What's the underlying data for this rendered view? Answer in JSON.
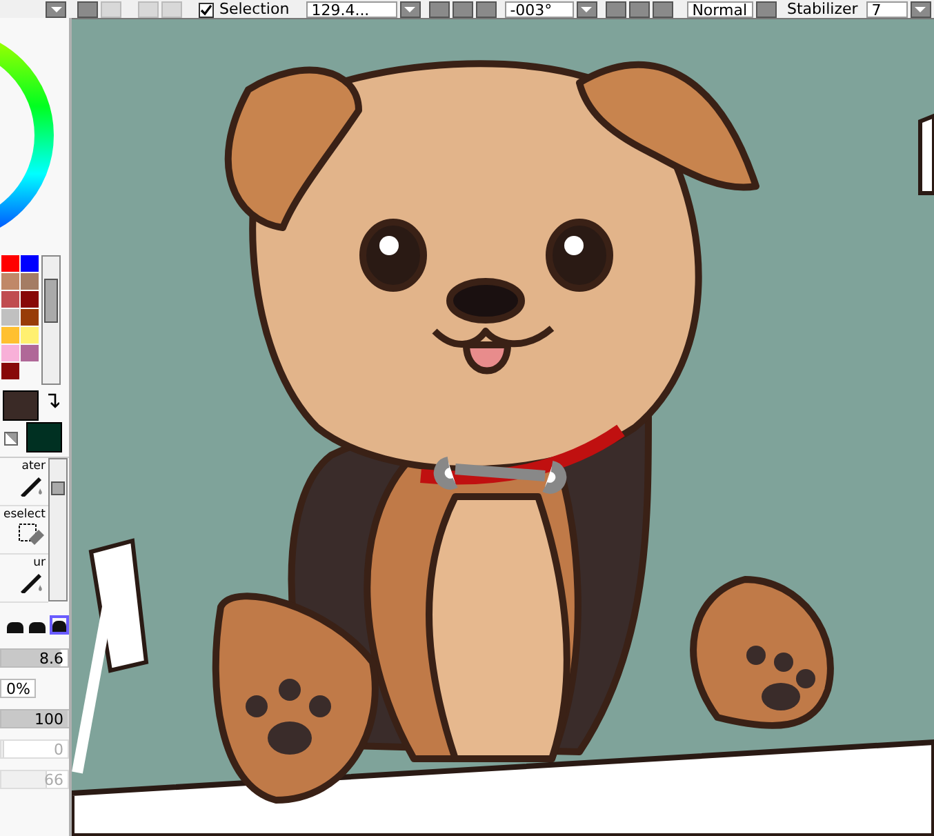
{
  "toolbar": {
    "selection": {
      "label": "Selection",
      "checked": true
    },
    "zoom": {
      "value": "129.4..."
    },
    "angle": {
      "value": "-003°"
    },
    "blend_mode": "Normal",
    "stabilizer": {
      "label": "Stabilizer",
      "value": "7"
    }
  },
  "swatches": [
    {
      "color": "#ff0000"
    },
    {
      "color": "#0000ff"
    },
    {
      "color": "#c08868"
    },
    {
      "color": "#a47c64"
    },
    {
      "color": "#c04c50"
    },
    {
      "color": "#880808"
    },
    {
      "color": "#c0c0c0"
    },
    {
      "color": "#983c08"
    },
    {
      "color": "#ffc030"
    },
    {
      "color": "#fff070"
    },
    {
      "color": "#f8b0d8"
    },
    {
      "color": "#b06898"
    },
    {
      "color": "#880808"
    }
  ],
  "colors": {
    "primary": {
      "color": "#3a2a26"
    },
    "secondary": {
      "color": "#003022"
    }
  },
  "tools": [
    {
      "label": "ater",
      "kind": "brush"
    },
    {
      "label": "eselect",
      "kind": "eraser"
    },
    {
      "label": "ur",
      "kind": "brush"
    }
  ],
  "brush_shapes": [
    {
      "selected": false
    },
    {
      "selected": false
    },
    {
      "selected": true
    }
  ],
  "sliders": [
    {
      "reading": "8.6",
      "level": 0.88,
      "kind": "bar"
    },
    {
      "reading": "0%",
      "kind": "field"
    },
    {
      "reading": "100",
      "level": 1,
      "kind": "bar"
    },
    {
      "reading": "0",
      "level": 0,
      "kind": "dim"
    },
    {
      "reading": "66",
      "level": 0.66,
      "kind": "dim"
    }
  ]
}
